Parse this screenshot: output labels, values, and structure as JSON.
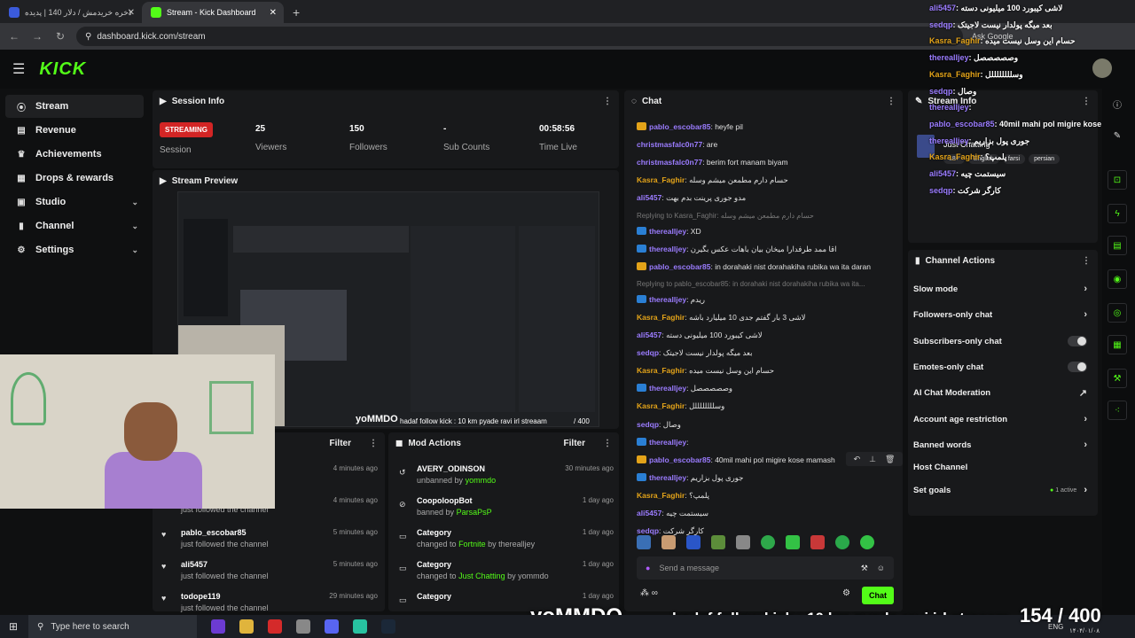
{
  "browser": {
    "tabs": [
      {
        "label": "بلاخره خریدمش / دلار 140 | پدیده",
        "active": false
      },
      {
        "label": "Stream - Kick Dashboard",
        "active": true
      }
    ],
    "url": "dashboard.kick.com/stream",
    "ask_google": "Ask Google"
  },
  "nav": {
    "logo": "KICK"
  },
  "sidebar": {
    "items": [
      {
        "label": "Stream",
        "icon": "broadcast-icon",
        "glyph": "((·))",
        "active": true
      },
      {
        "label": "Revenue",
        "icon": "revenue-icon",
        "glyph": "▤"
      },
      {
        "label": "Achievements",
        "icon": "trophy-icon",
        "glyph": "🏆"
      },
      {
        "label": "Drops & rewards",
        "icon": "gift-icon",
        "glyph": "▦"
      },
      {
        "label": "Studio",
        "icon": "studio-icon",
        "glyph": "▣",
        "chevron": "⌄"
      },
      {
        "label": "Channel",
        "icon": "channel-icon",
        "glyph": "▮",
        "chevron": "⌄"
      },
      {
        "label": "Settings",
        "icon": "gear-icon",
        "glyph": "⚙",
        "chevron": "⌄"
      }
    ]
  },
  "session": {
    "title": "Session Info",
    "status": "STREAMING",
    "session_label": "Session",
    "stats": [
      {
        "value": "25",
        "label": "Viewers"
      },
      {
        "value": "150",
        "label": "Followers"
      },
      {
        "value": "-",
        "label": "Sub Counts"
      },
      {
        "value": "00:58:56",
        "label": "Time Live"
      }
    ]
  },
  "preview": {
    "title": "Stream Preview",
    "overlay_text": "hadaf follow kick : 10 km pyade ravi irl streaam",
    "counter": "/ 400",
    "logo_text": "yoMMDO"
  },
  "activity": {
    "filter_label": "Filter",
    "rows": [
      {
        "name": "",
        "sub": "just followed the channel",
        "time": "4 minutes ago"
      },
      {
        "name": "",
        "sub": "just followed the channel",
        "time": "4 minutes ago"
      },
      {
        "name": "pablo_escobar85",
        "sub": "just followed the channel",
        "time": "5 minutes ago"
      },
      {
        "name": "ali5457",
        "sub": "just followed the channel",
        "time": "5 minutes ago"
      },
      {
        "name": "todope119",
        "sub": "just followed the channel",
        "time": "29 minutes ago"
      }
    ]
  },
  "mod_actions": {
    "title": "Mod Actions",
    "filter_label": "Filter",
    "rows": [
      {
        "name": "AVERY_ODINSON",
        "verb": "unbanned by",
        "by": "yommdo",
        "extra": "",
        "time": "30 minutes ago"
      },
      {
        "name": "CoopoloopBot",
        "verb": "banned by",
        "by": "ParsaPsP",
        "extra": "",
        "time": "1 day ago"
      },
      {
        "name": "Category",
        "verb": "changed to",
        "by": "Fortnite",
        "extra": "by therealljey",
        "time": "1 day ago"
      },
      {
        "name": "Category",
        "verb": "changed to",
        "by": "Just Chatting",
        "extra": "by yommdo",
        "time": "1 day ago"
      },
      {
        "name": "Category",
        "verb": "",
        "by": "",
        "extra": "",
        "time": "1 day ago"
      }
    ]
  },
  "chat": {
    "title": "Chat",
    "placeholder": "Send a message",
    "send_label": "Chat",
    "messages": [
      {
        "user": "pablo_escobar85",
        "color": "#9b7cff",
        "badge": "#e3a319",
        "text": "heyfe pil"
      },
      {
        "user": "christmasfalc0n77",
        "color": "#9b7cff",
        "badge": "",
        "text": "are"
      },
      {
        "user": "christmasfalc0n77",
        "color": "#9b7cff",
        "badge": "",
        "text": "berim fort manam biyam"
      },
      {
        "user": "Kasra_Faghir",
        "color": "#e3a319",
        "badge": "",
        "text": "حسام دارم مطمعن میشم وسله"
      },
      {
        "user": "ali5457",
        "color": "#9b7cff",
        "badge": "",
        "text": "مدو جوری پرینت بدم بهت"
      },
      {
        "reply": "Replying to Kasra_Faghir: حسام دارم مطمعن میشم وسله"
      },
      {
        "user": "therealljey",
        "color": "#9b7cff",
        "badge": "#2a7fd4",
        "text": "XD"
      },
      {
        "user": "therealljey",
        "color": "#9b7cff",
        "badge": "#2a7fd4",
        "text": "اقا ممد طرفدارا میخان بیان باهات عکس بگیرن"
      },
      {
        "user": "pablo_escobar85",
        "color": "#9b7cff",
        "badge": "#e3a319",
        "text": "in dorahaki nist dorahakiha rubika wa ita daran"
      },
      {
        "reply": "Replying to pablo_escobar85: in dorahaki nist dorahakiha rubika wa ita..."
      },
      {
        "user": "therealljey",
        "color": "#9b7cff",
        "badge": "#2a7fd4",
        "text": "ریدم"
      },
      {
        "user": "Kasra_Faghir",
        "color": "#e3a319",
        "badge": "",
        "text": "لاشی 3 بار گفتم جدی 10 میلیارد باشه"
      },
      {
        "user": "ali5457",
        "color": "#9b7cff",
        "badge": "",
        "text": "لاشی کیبورد 100 میلیونی دسته"
      },
      {
        "user": "sedqp",
        "color": "#9b7cff",
        "badge": "",
        "text": "بعد میگه پولدار نیست لاجیتک"
      },
      {
        "user": "Kasra_Faghir",
        "color": "#e3a319",
        "badge": "",
        "text": "حسام این وسل نیست میده"
      },
      {
        "user": "therealljey",
        "color": "#9b7cff",
        "badge": "#2a7fd4",
        "text": "وصصصصصل"
      },
      {
        "user": "Kasra_Faghir",
        "color": "#e3a319",
        "badge": "",
        "text": "وسللللللللل"
      },
      {
        "user": "sedqp",
        "color": "#9b7cff",
        "badge": "",
        "text": "وصال"
      },
      {
        "user": "therealljey",
        "color": "#9b7cff",
        "badge": "#2a7fd4",
        "text": ""
      },
      {
        "user": "pablo_escobar85",
        "color": "#9b7cff",
        "badge": "#e3a319",
        "text": "40mil mahi pol migire kose mamash"
      },
      {
        "user": "therealljey",
        "color": "#9b7cff",
        "badge": "#2a7fd4",
        "text": "جوری پول بزاریم"
      },
      {
        "user": "Kasra_Faghir",
        "color": "#e3a319",
        "badge": "",
        "text": "پلمپ؟"
      },
      {
        "user": "ali5457",
        "color": "#9b7cff",
        "badge": "",
        "text": "سیستمت چیه"
      },
      {
        "user": "sedqp",
        "color": "#9b7cff",
        "badge": "",
        "text": "کارگر شرکت"
      }
    ]
  },
  "stream_info": {
    "title": "Stream Info",
    "category": "Just Chatting",
    "tags": [
      "18+",
      "English",
      "farsi",
      "persian"
    ]
  },
  "overlay_chat": [
    {
      "user": "ali5457",
      "color": "#9b7cff",
      "text": "لاشی کیبورد 100 میلیونی دسته"
    },
    {
      "user": "sedqp",
      "color": "#9b7cff",
      "text": "بعد میگه پولدار نیست لاجیتک"
    },
    {
      "user": "Kasra_Faghir",
      "color": "#e3a319",
      "text": "حسام این وسل نیست میده"
    },
    {
      "user": "therealljey",
      "color": "#9b7cff",
      "text": "وصصصصصل"
    },
    {
      "user": "Kasra_Faghir",
      "color": "#e3a319",
      "text": "وسللللللللل"
    },
    {
      "user": "sedqp",
      "color": "#9b7cff",
      "text": "وصال"
    },
    {
      "user": "therealljey",
      "color": "#9b7cff",
      "text": ""
    },
    {
      "user": "pablo_escobar85",
      "color": "#9b7cff",
      "text": "40mil mahi pol migire kose mamash"
    },
    {
      "user": "therealljey",
      "color": "#9b7cff",
      "text": "جوری پول بزاریم"
    },
    {
      "user": "Kasra_Faghir",
      "color": "#e3a319",
      "text": "پلمپ؟"
    },
    {
      "user": "ali5457",
      "color": "#9b7cff",
      "text": "سیستمت چیه"
    },
    {
      "user": "sedqp",
      "color": "#9b7cff",
      "text": "کارگر شرکت"
    }
  ],
  "channel_actions": {
    "title": "Channel Actions",
    "items": [
      {
        "label": "Slow mode",
        "ctrl": "chevron"
      },
      {
        "label": "Followers-only chat",
        "ctrl": "chevron"
      },
      {
        "label": "Subscribers-only chat",
        "ctrl": "toggle"
      },
      {
        "label": "Emotes-only chat",
        "ctrl": "toggle"
      },
      {
        "label": "AI Chat Moderation",
        "ctrl": "link"
      },
      {
        "label": "Account age restriction",
        "ctrl": "chevron"
      },
      {
        "label": "Banned words",
        "ctrl": "chevron"
      },
      {
        "label": "Host Channel",
        "ctrl": "none"
      },
      {
        "label": "Set goals",
        "ctrl": "chevron",
        "extra": "1 active"
      }
    ]
  },
  "bottom_overlay": {
    "title": "hadaf follow kick : 10 km pyade ravi irl streaam",
    "count": "154",
    "total": "/ 400",
    "logo": "yoMMDO"
  },
  "taskbar": {
    "search_placeholder": "Type here to search",
    "lang": "ENG",
    "date": "۱۴۰۴/۰۱/۰۸"
  },
  "colors": {
    "accent": "#53fc18",
    "live": "#d32525"
  }
}
